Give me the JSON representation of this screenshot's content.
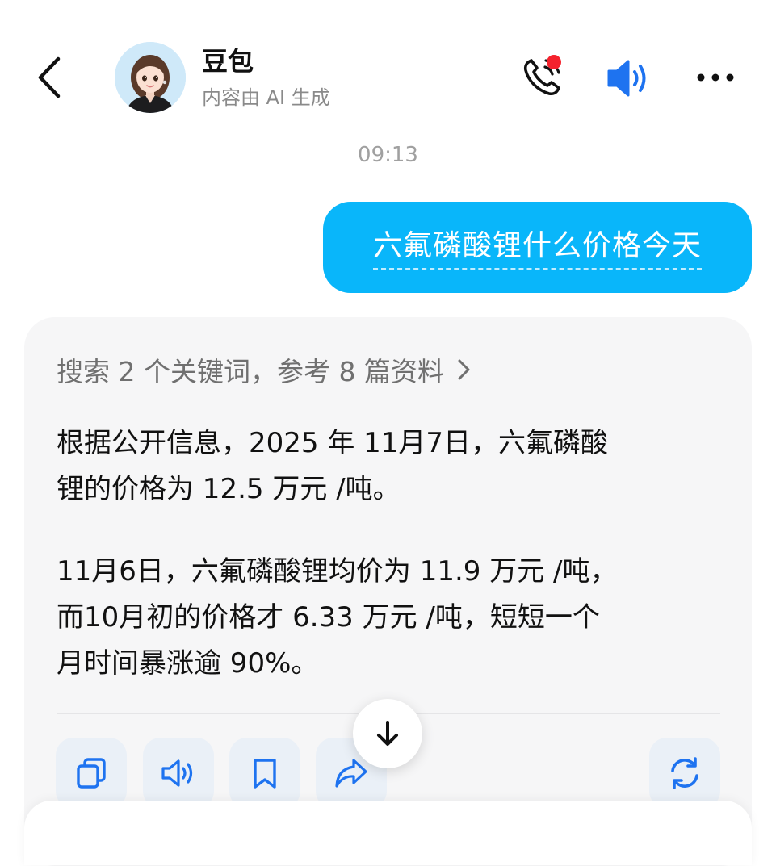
{
  "header": {
    "bot_name": "豆包",
    "bot_subtitle": "内容由 AI 生成"
  },
  "icons": {
    "back": "chevron-left-icon",
    "call": "phone-icon",
    "speaker": "speaker-icon",
    "more": "more-icon",
    "copy": "copy-icon",
    "read_aloud": "speaker-icon",
    "bookmark": "bookmark-icon",
    "share": "share-icon",
    "regenerate": "refresh-icon",
    "scroll_down": "arrow-down-icon"
  },
  "colors": {
    "accent_blue": "#09b6fa",
    "icon_blue": "#1e73f0",
    "notification_red": "#f5222d",
    "card_bg": "#f6f6f7"
  },
  "chat": {
    "timestamp": "09:13",
    "user_message": "六氟磷酸锂什么价格今天",
    "ai": {
      "search_summary": "搜索 2 个关键词，参考 8 篇资料",
      "paragraph1_line1": "根据公开信息，2025 年 11月7日，六氟磷酸",
      "paragraph1_line2": "锂的价格为 12.5 万元 /吨。",
      "paragraph2_line1": "11月6日，六氟磷酸锂均价为 11.9 万元 /吨，",
      "paragraph2_line2": "而10月初的价格才 6.33 万元 /吨，短短一个",
      "paragraph2_line3": "月时间暴涨逾 90%。"
    }
  }
}
